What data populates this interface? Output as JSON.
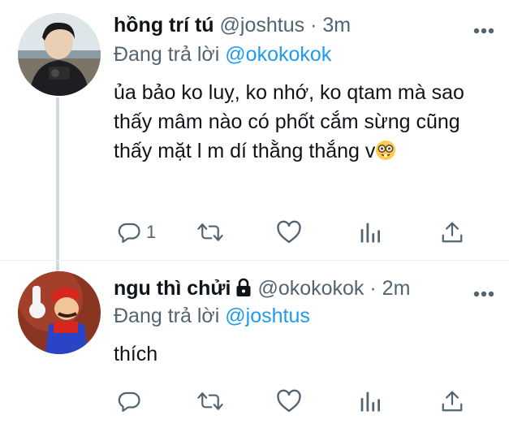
{
  "tweets": [
    {
      "display_name": "hồng trí tú",
      "handle": "@joshtus",
      "separator": "·",
      "time": "3m",
      "replying_label": "Đang trả lời",
      "replying_to": "@okokokok",
      "text": "ủa bảo ko luỵ, ko nhớ, ko qtam mà sao thấy mâm nào có phốt cắm sừng cũng thấy mặt l m dí thằng thắng v",
      "emoji": "nerd-face",
      "reply_count": "1",
      "locked": false
    },
    {
      "display_name": "ngu thì chửi",
      "handle": "@okokokok",
      "separator": "·",
      "time": "2m",
      "replying_label": "Đang trả lời",
      "replying_to": "@joshtus",
      "text": "thích",
      "reply_count": "",
      "locked": true
    }
  ],
  "icons": {
    "reply": "reply-icon",
    "retweet": "retweet-icon",
    "like": "heart-icon",
    "analytics": "analytics-icon",
    "share": "share-icon",
    "more": "more-icon",
    "lock": "lock-icon"
  },
  "colors": {
    "text": "#0f1419",
    "secondary": "#536471",
    "accent": "#1d9bf0",
    "thread_line": "#cfd9de"
  }
}
